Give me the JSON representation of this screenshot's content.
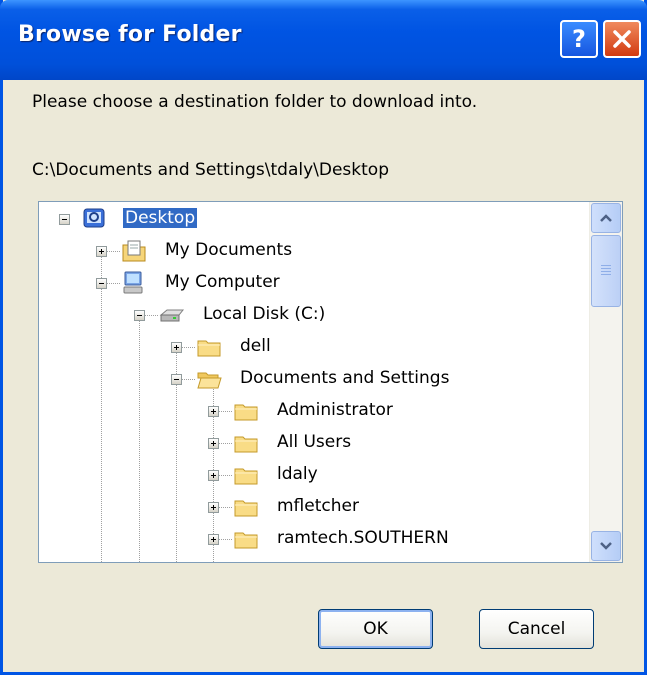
{
  "window": {
    "title": "Browse for Folder",
    "help_label": "?",
    "close_label": "×"
  },
  "dialog": {
    "prompt": "Please choose a destination folder to download into.",
    "current_path": "C:\\Documents and Settings\\tdaly\\Desktop"
  },
  "tree": {
    "nodes": [
      {
        "label": "Desktop",
        "icon": "desktop-icon",
        "expander": "minus",
        "selected": true
      },
      {
        "label": "My Documents",
        "icon": "my-documents-icon",
        "expander": "plus"
      },
      {
        "label": "My Computer",
        "icon": "computer-icon",
        "expander": "minus"
      },
      {
        "label": "Local Disk (C:)",
        "icon": "drive-icon",
        "expander": "minus"
      },
      {
        "label": "dell",
        "icon": "folder-icon",
        "expander": "plus"
      },
      {
        "label": "Documents and Settings",
        "icon": "folder-icon",
        "expander": "minus"
      },
      {
        "label": "Administrator",
        "icon": "folder-icon",
        "expander": "plus"
      },
      {
        "label": "All Users",
        "icon": "folder-icon",
        "expander": "plus"
      },
      {
        "label": "ldaly",
        "icon": "folder-icon",
        "expander": "plus"
      },
      {
        "label": "mfletcher",
        "icon": "folder-icon",
        "expander": "plus"
      },
      {
        "label": "ramtech.SOUTHERN",
        "icon": "folder-icon",
        "expander": "plus"
      }
    ]
  },
  "buttons": {
    "ok_label": "OK",
    "cancel_label": "Cancel"
  },
  "colors": {
    "titlebar": "#0054e3",
    "selection": "#316ac5",
    "dialog_bg": "#ece9d8"
  }
}
